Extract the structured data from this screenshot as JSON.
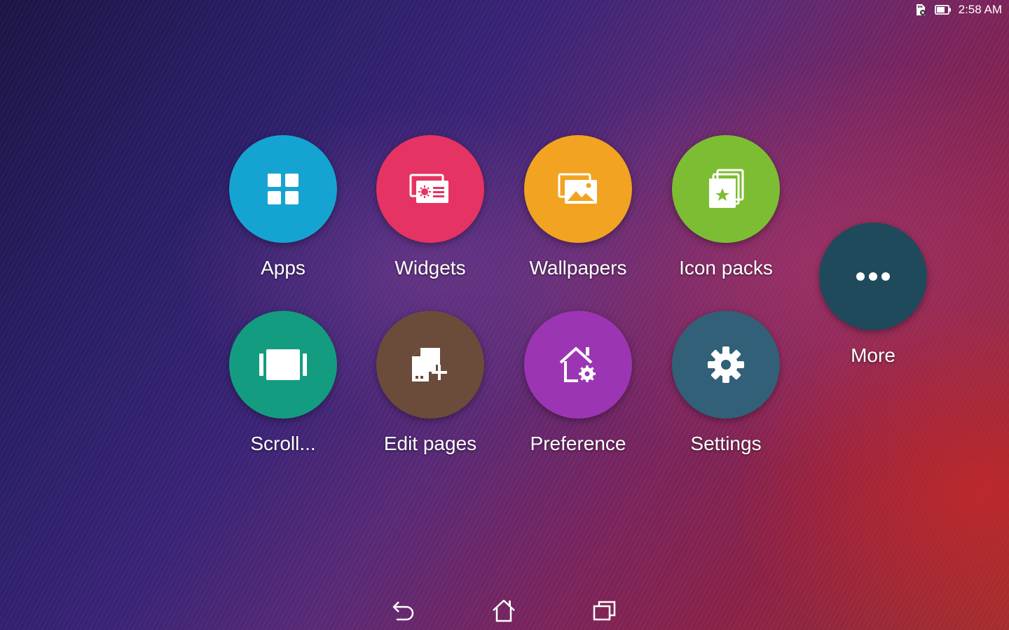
{
  "status_bar": {
    "time": "2:58 AM",
    "icons": [
      "sd-card-icon",
      "battery-icon"
    ]
  },
  "menu": {
    "items": [
      {
        "label": "Apps",
        "icon": "apps-grid-icon",
        "color": "#15a4d2"
      },
      {
        "label": "Widgets",
        "icon": "widgets-icon",
        "color": "#e53363"
      },
      {
        "label": "Wallpapers",
        "icon": "wallpapers-icon",
        "color": "#f2a321"
      },
      {
        "label": "Icon packs",
        "icon": "icon-packs-icon",
        "color": "#7dbd33"
      },
      {
        "label": "Scroll...",
        "icon": "scroll-effect-icon",
        "color": "#149c80"
      },
      {
        "label": "Edit pages",
        "icon": "edit-pages-icon",
        "color": "#6b4c3a"
      },
      {
        "label": "Preference",
        "icon": "preference-icon",
        "color": "#9c35b4"
      },
      {
        "label": "Settings",
        "icon": "gear-icon",
        "color": "#326079"
      },
      {
        "label": "More",
        "icon": "more-dots-icon",
        "color": "#1f4a5c"
      }
    ]
  },
  "nav_bar": {
    "buttons": [
      "back-icon",
      "home-icon",
      "recents-icon"
    ]
  }
}
